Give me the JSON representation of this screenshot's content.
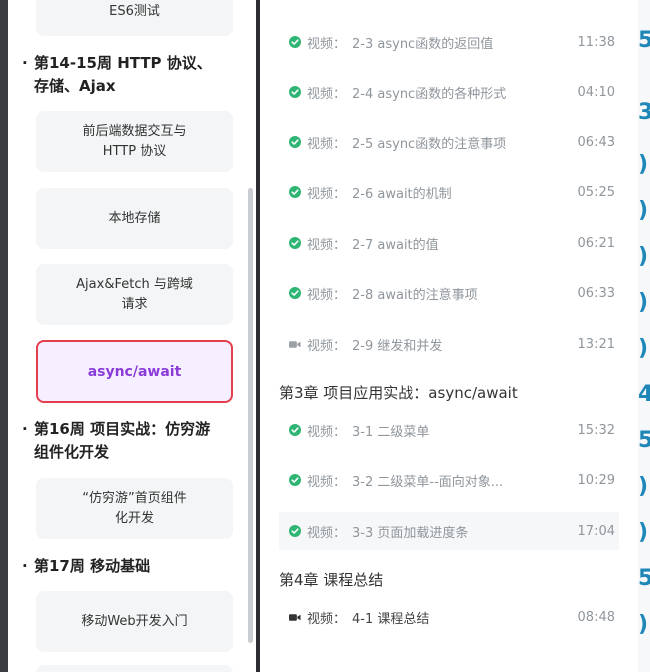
{
  "sidebar": {
    "top_card": "ES6测试",
    "weeks": [
      {
        "line1": "第14-15周 HTTP 协议、",
        "line2": "存储、Ajax"
      },
      {
        "line1": "第16周 项目实战：仿穷游",
        "line2": "组件化开发"
      },
      {
        "line1": "第17周 移动基础",
        "line2": ""
      }
    ],
    "cards": {
      "http_l1": "前后端数据交互与",
      "http_l2": "HTTP 协议",
      "storage": "本地存储",
      "ajax_l1": "Ajax&Fetch 与跨域",
      "ajax_l2": "请求",
      "async": "async/await",
      "qiongyou_l1": "“仿穷游”首页组件",
      "qiongyou_l2": "化开发",
      "mobile": "移动Web开发入门"
    }
  },
  "lessons": [
    {
      "icon": "check-circle-icon",
      "type": "视频：",
      "title": "2-3 async函数的返回值",
      "duration": "11:38"
    },
    {
      "icon": "check-circle-icon",
      "type": "视频：",
      "title": "2-4 async函数的各种形式",
      "duration": "04:10"
    },
    {
      "icon": "check-circle-icon",
      "type": "视频：",
      "title": "2-5 async函数的注意事项",
      "duration": "06:43"
    },
    {
      "icon": "check-circle-icon",
      "type": "视频：",
      "title": "2-6 await的机制",
      "duration": "05:25"
    },
    {
      "icon": "check-circle-icon",
      "type": "视频：",
      "title": "2-7 await的值",
      "duration": "06:21"
    },
    {
      "icon": "check-circle-icon",
      "type": "视频：",
      "title": "2-8 await的注意事项",
      "duration": "06:33"
    },
    {
      "icon": "video-camera-icon",
      "type": "视频：",
      "title": "2-9 继发和并发",
      "duration": "13:21"
    },
    {
      "icon": "check-circle-icon",
      "type": "视频：",
      "title": "3-1 二级菜单",
      "duration": "15:32"
    },
    {
      "icon": "check-circle-icon",
      "type": "视频：",
      "title": "3-2 二级菜单--面向对象...",
      "duration": "10:29"
    },
    {
      "icon": "check-circle-icon",
      "type": "视频：",
      "title": "3-3 页面加载进度条",
      "duration": "17:04"
    },
    {
      "icon": "video-camera-icon",
      "type": "视频：",
      "title": "4-1 课程总结",
      "duration": "08:48"
    }
  ],
  "chapters": {
    "ch3": "第3章  项目应用实战：async/await",
    "ch4": "第4章  课程总结"
  },
  "colors": {
    "check": "#2fb573",
    "active_border": "#e53e4f",
    "active_text": "#8b3bd7"
  }
}
